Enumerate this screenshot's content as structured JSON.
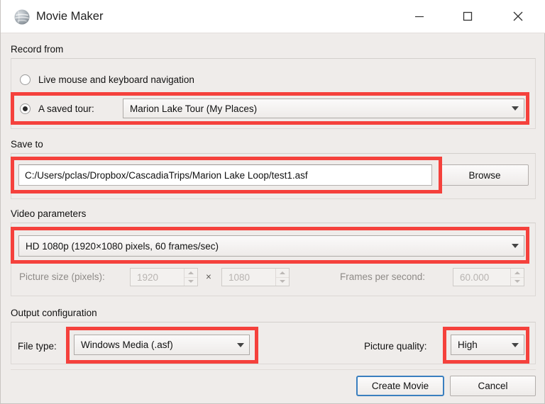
{
  "window": {
    "title": "Movie Maker",
    "icon": "globe-icon",
    "controls": {
      "minimize": "minimize-icon",
      "maximize": "maximize-icon",
      "close": "close-icon"
    }
  },
  "colors": {
    "highlight": "#f5413c",
    "background": "#efecea",
    "titlebar": "#ffffff",
    "default_button_border": "#3a7fbf"
  },
  "record_from": {
    "label": "Record from",
    "options": [
      {
        "label": "Live mouse and keyboard navigation",
        "selected": false
      },
      {
        "label": "A saved tour:",
        "selected": true
      }
    ],
    "saved_tour_combo": {
      "value": "Marion Lake Tour (My Places)",
      "arrow": "chevron-down-icon"
    }
  },
  "save_to": {
    "label": "Save to",
    "path_value": "C:/Users/pclas/Dropbox/CascadiaTrips/Marion Lake Loop/test1.asf",
    "path_placeholder": "",
    "browse_label": "Browse"
  },
  "video_parameters": {
    "label": "Video parameters",
    "preset_combo": {
      "value": "HD 1080p (1920×1080 pixels, 60 frames/sec)",
      "arrow": "chevron-down-icon"
    },
    "picture_size_label": "Picture size (pixels):",
    "picture_width": "1920",
    "separator": "×",
    "picture_height": "1080",
    "fps_label": "Frames per second:",
    "fps_value": "60.000"
  },
  "output_configuration": {
    "label": "Output configuration",
    "file_type_label": "File type:",
    "file_type_value": "Windows Media (.asf)",
    "picture_quality_label": "Picture quality:",
    "picture_quality_value": "High"
  },
  "footer": {
    "create_label": "Create Movie",
    "cancel_label": "Cancel"
  }
}
